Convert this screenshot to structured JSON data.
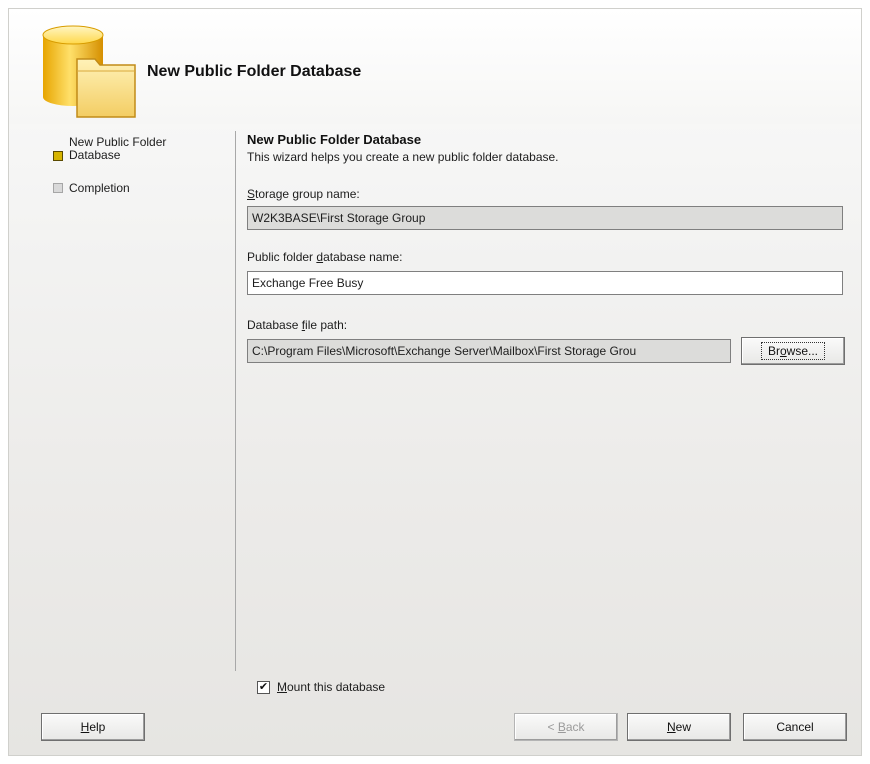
{
  "header": {
    "title": "New Public Folder Database"
  },
  "sidebar": {
    "steps": [
      {
        "label_line1": "New Public Folder",
        "label_line2": "Database",
        "state": "active"
      },
      {
        "label_line1": "Completion",
        "label_line2": "",
        "state": "inactive"
      }
    ]
  },
  "main": {
    "section_title": "New Public Folder Database",
    "section_description": "This wizard helps you create a new public folder database.",
    "storage_group": {
      "label_prefix": "",
      "label_accel": "S",
      "label_rest": "torage group name:",
      "value": "W2K3BASE\\First Storage Group"
    },
    "db_name": {
      "label_prefix": "Public folder ",
      "label_accel": "d",
      "label_rest": "atabase name:",
      "value": "Exchange Free Busy"
    },
    "file_path": {
      "label_prefix": "Database ",
      "label_accel": "f",
      "label_rest": "ile path:",
      "value": "C:\\Program Files\\Microsoft\\Exchange Server\\Mailbox\\First Storage Grou",
      "browse_prefix": "Br",
      "browse_accel": "o",
      "browse_rest": "wse..."
    },
    "mount": {
      "checked": true,
      "check_glyph": "✔",
      "label_accel": "M",
      "label_rest": "ount this database"
    }
  },
  "footer": {
    "help": {
      "accel": "H",
      "rest": "elp"
    },
    "back": {
      "prefix": "< ",
      "accel": "B",
      "rest": "ack"
    },
    "new": {
      "accel": "N",
      "rest": "ew"
    },
    "cancel": {
      "label": "Cancel"
    }
  },
  "colors": {
    "active_step": "#d6b400",
    "inactive_step": "#d9d9d9",
    "readonly_field": "#dcdcda"
  }
}
